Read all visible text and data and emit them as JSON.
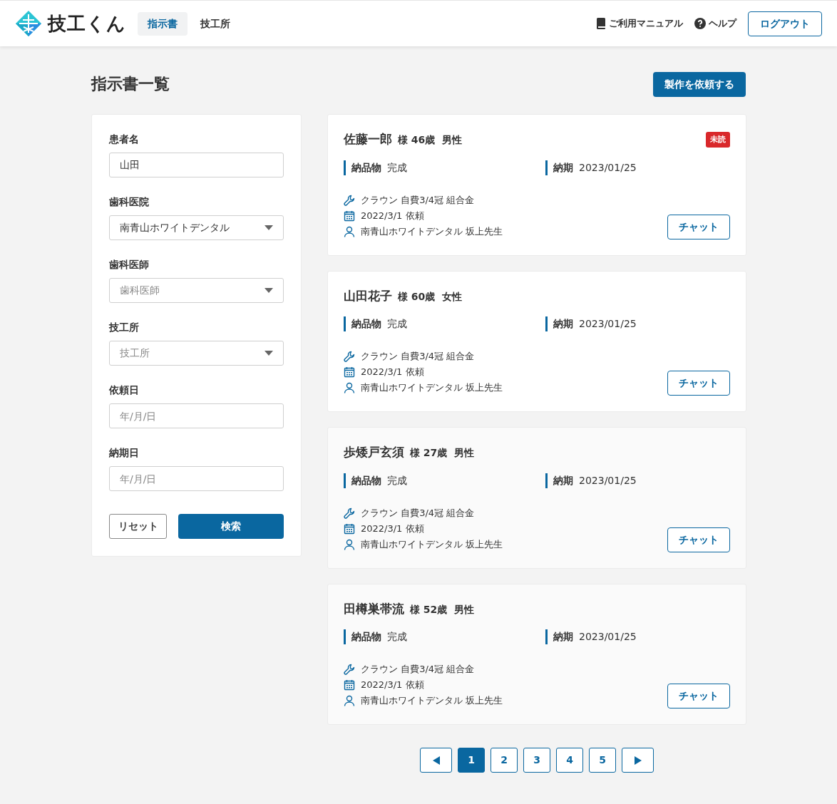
{
  "header": {
    "logo_text": "技工くん",
    "nav": [
      {
        "label": "指示書",
        "selected": true
      },
      {
        "label": "技工所",
        "selected": false
      }
    ],
    "manual_link": "ご利用マニュアル",
    "help_link": "ヘルプ",
    "logout_button": "ログアウト"
  },
  "page": {
    "title": "指示書一覧",
    "create_button": "製作を依頼する"
  },
  "filters": [
    {
      "kind": "text",
      "label": "患者名",
      "value": "山田"
    },
    {
      "kind": "select",
      "label": "歯科医院",
      "value": "南青山ホワイトデンタル"
    },
    {
      "kind": "select",
      "label": "歯科医師",
      "placeholder": "歯科医師"
    },
    {
      "kind": "select",
      "label": "技工所",
      "placeholder": "技工所"
    },
    {
      "kind": "date",
      "label": "依頼日",
      "placeholder": "年/月/日"
    },
    {
      "kind": "date",
      "label": "納期日",
      "placeholder": "年/月/日"
    }
  ],
  "filter_buttons": {
    "reset": "リセット",
    "search": "検索"
  },
  "orders": [
    {
      "name": "佐藤一郎",
      "honorific": "様",
      "age": "46歳",
      "sex": "男性",
      "unread": true,
      "unread_label": "未読",
      "muted": false,
      "delivery_label": "納品物",
      "delivery": "完成",
      "due_label": "納期",
      "due": "2023/01/25",
      "item": "クラウン 自費3/4冠 組合金",
      "requested": "2022/3/1 依頼",
      "clinic": "南青山ホワイトデンタル 坂上先生",
      "chat_button": "チャット"
    },
    {
      "name": "山田花子",
      "honorific": "様",
      "age": "60歳",
      "sex": "女性",
      "unread": false,
      "muted": false,
      "delivery_label": "納品物",
      "delivery": "完成",
      "due_label": "納期",
      "due": "2023/01/25",
      "item": "クラウン 自費3/4冠 組合金",
      "requested": "2022/3/1 依頼",
      "clinic": "南青山ホワイトデンタル 坂上先生",
      "chat_button": "チャット"
    },
    {
      "name": "歩矮戸玄須",
      "honorific": "様",
      "age": "27歳",
      "sex": "男性",
      "unread": false,
      "muted": true,
      "delivery_label": "納品物",
      "delivery": "完成",
      "due_label": "納期",
      "due": "2023/01/25",
      "item": "クラウン 自費3/4冠 組合金",
      "requested": "2022/3/1 依頼",
      "clinic": "南青山ホワイトデンタル 坂上先生",
      "chat_button": "チャット"
    },
    {
      "name": "田樽巣帯流",
      "honorific": "様",
      "age": "52歳",
      "sex": "男性",
      "unread": false,
      "muted": true,
      "delivery_label": "納品物",
      "delivery": "完成",
      "due_label": "納期",
      "due": "2023/01/25",
      "item": "クラウン 自費3/4冠 組合金",
      "requested": "2022/3/1 依頼",
      "clinic": "南青山ホワイトデンタル 坂上先生",
      "chat_button": "チャット"
    }
  ],
  "pagination": [
    {
      "kind": "prev"
    },
    {
      "kind": "page",
      "label": "1",
      "selected": true
    },
    {
      "kind": "page",
      "label": "2",
      "selected": false
    },
    {
      "kind": "page",
      "label": "3",
      "selected": false
    },
    {
      "kind": "page",
      "label": "4",
      "selected": false
    },
    {
      "kind": "page",
      "label": "5",
      "selected": false
    },
    {
      "kind": "next"
    }
  ]
}
